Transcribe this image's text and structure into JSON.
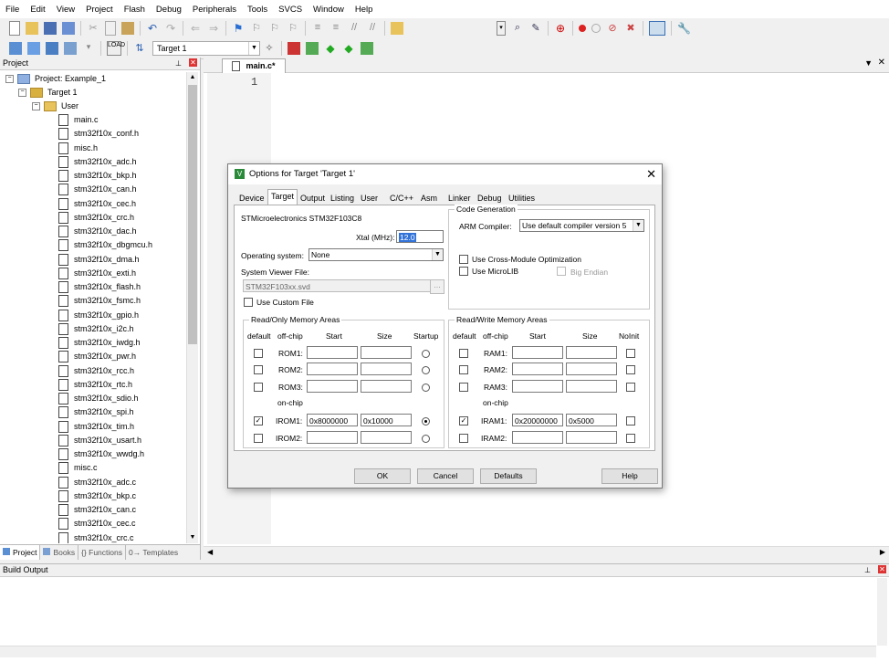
{
  "menu": [
    "File",
    "Edit",
    "View",
    "Project",
    "Flash",
    "Debug",
    "Peripherals",
    "Tools",
    "SVCS",
    "Window",
    "Help"
  ],
  "toolbar2": {
    "target_select": "Target 1"
  },
  "project_panel": {
    "title": "Project",
    "root": "Project: Example_1",
    "target": "Target 1",
    "group": "User",
    "files": [
      "main.c",
      "stm32f10x_conf.h",
      "misc.h",
      "stm32f10x_adc.h",
      "stm32f10x_bkp.h",
      "stm32f10x_can.h",
      "stm32f10x_cec.h",
      "stm32f10x_crc.h",
      "stm32f10x_dac.h",
      "stm32f10x_dbgmcu.h",
      "stm32f10x_dma.h",
      "stm32f10x_exti.h",
      "stm32f10x_flash.h",
      "stm32f10x_fsmc.h",
      "stm32f10x_gpio.h",
      "stm32f10x_i2c.h",
      "stm32f10x_iwdg.h",
      "stm32f10x_pwr.h",
      "stm32f10x_rcc.h",
      "stm32f10x_rtc.h",
      "stm32f10x_sdio.h",
      "stm32f10x_spi.h",
      "stm32f10x_tim.h",
      "stm32f10x_usart.h",
      "stm32f10x_wwdg.h",
      "misc.c",
      "stm32f10x_adc.c",
      "stm32f10x_bkp.c",
      "stm32f10x_can.c",
      "stm32f10x_cec.c",
      "stm32f10x_crc.c"
    ],
    "bottom_tabs": [
      "Project",
      "Books",
      "{} Functions",
      "0→ Templates"
    ]
  },
  "editor": {
    "tab": "main.c*",
    "line_number": "1"
  },
  "build_output": {
    "title": "Build Output"
  },
  "dialog": {
    "title": "Options for Target 'Target 1'",
    "tabs": [
      "Device",
      "Target",
      "Output",
      "Listing",
      "User",
      "C/C++",
      "Asm",
      "Linker",
      "Debug",
      "Utilities"
    ],
    "device_name": "STMicroelectronics STM32F103C8",
    "xtal_label": "Xtal (MHz):",
    "xtal_value": "12.0",
    "os_label": "Operating system:",
    "os_value": "None",
    "svd_label": "System Viewer File:",
    "svd_value": "STM32F103xx.svd",
    "custom_file_label": "Use Custom File",
    "codegen": {
      "title": "Code Generation",
      "compiler_label": "ARM Compiler:",
      "compiler_value": "Use default compiler version 5",
      "cross_module": "Use Cross-Module Optimization",
      "microlib": "Use MicroLIB",
      "big_endian": "Big Endian"
    },
    "rom": {
      "title": "Read/Only Memory Areas",
      "headers": [
        "default",
        "off-chip",
        "Start",
        "Size",
        "Startup"
      ],
      "onchip": "on-chip",
      "rows": [
        {
          "name": "ROM1:",
          "start": "",
          "size": ""
        },
        {
          "name": "ROM2:",
          "start": "",
          "size": ""
        },
        {
          "name": "ROM3:",
          "start": "",
          "size": ""
        },
        {
          "name": "IROM1:",
          "start": "0x8000000",
          "size": "0x10000"
        },
        {
          "name": "IROM2:",
          "start": "",
          "size": ""
        }
      ]
    },
    "ram": {
      "title": "Read/Write Memory Areas",
      "headers": [
        "default",
        "off-chip",
        "Start",
        "Size",
        "NoInit"
      ],
      "onchip": "on-chip",
      "rows": [
        {
          "name": "RAM1:",
          "start": "",
          "size": ""
        },
        {
          "name": "RAM2:",
          "start": "",
          "size": ""
        },
        {
          "name": "RAM3:",
          "start": "",
          "size": ""
        },
        {
          "name": "IRAM1:",
          "start": "0x20000000",
          "size": "0x5000"
        },
        {
          "name": "IRAM2:",
          "start": "",
          "size": ""
        }
      ]
    },
    "buttons": {
      "ok": "OK",
      "cancel": "Cancel",
      "defaults": "Defaults",
      "help": "Help"
    }
  }
}
